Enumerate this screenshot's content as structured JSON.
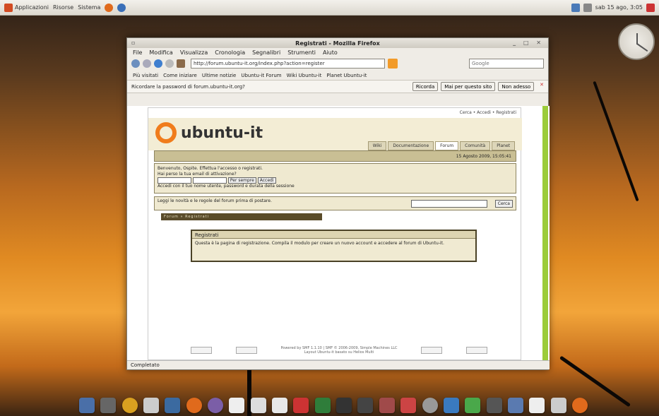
{
  "panel": {
    "applications": "Applicazioni",
    "places": "Risorse",
    "system": "Sistema",
    "clock": "sab 15 ago, 3:05"
  },
  "window": {
    "title": "Registrati - Mozilla Firefox"
  },
  "menu": [
    "File",
    "Modifica",
    "Visualizza",
    "Cronologia",
    "Segnalibri",
    "Strumenti",
    "Aiuto"
  ],
  "navbar": {
    "url": "http://forum.ubuntu-it.org/index.php?action=register",
    "search_placeholder": "Google"
  },
  "bookmarks": [
    "Più visitati",
    "Come iniziare",
    "Ultime notizie",
    "Ubuntu-it Forum",
    "Wiki Ubuntu-it",
    "Planet Ubuntu-it"
  ],
  "notification": {
    "text": "Ricordare la password di forum.ubuntu-it.org?",
    "remember": "Ricorda",
    "never": "Mai per questo sito",
    "not_now": "Non adesso"
  },
  "page": {
    "toplinks": "Cerca  •  Accedi  •  Registrati",
    "logo": "ubuntu-it",
    "tabs": [
      "Wiki",
      "Documentazione",
      "Forum",
      "Comunità",
      "Planet"
    ],
    "date": "15 Agosto 2009, 15:05:41",
    "login": {
      "welcome": "Benvenuto, Ospite. Effettua l'accesso o registrati.",
      "lost": "Hai perso la tua email di attivazione?",
      "duration": "Per sempre",
      "login_btn": "Accedi",
      "hint": "Accedi con il tuo nome utente, password e durata della sessione"
    },
    "search": {
      "text": "Leggi le novità e le regole del forum prima di postare.",
      "button": "Cerca"
    },
    "breadcrumb": "Forum » Registrati",
    "message": {
      "title": "Registrati",
      "body": "Questa è la pagina di registrazione. Compila il modulo per creare un nuovo account e accedere al forum di Ubuntu-it."
    },
    "footer": {
      "powered": "Powered by SMF 1.1.10 | SMF © 2006-2009, Simple Machines LLC",
      "extra": "Layout Ubuntu-it basato su Helios Multi"
    }
  },
  "status": "Completato"
}
